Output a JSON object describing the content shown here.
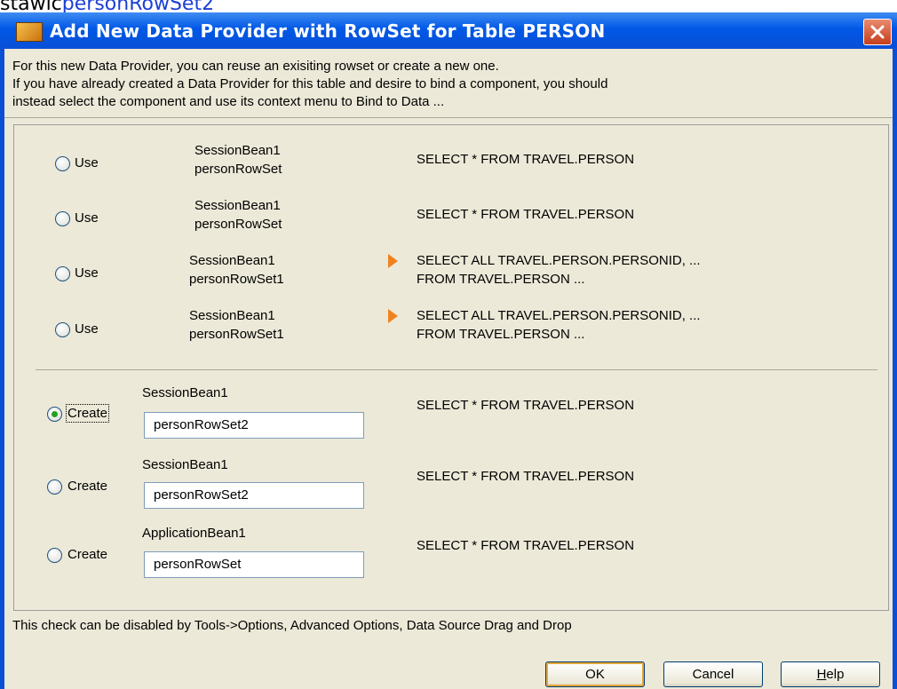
{
  "background": {
    "prefix": "stawic",
    "link": "personRowSet2"
  },
  "dialog": {
    "title": "Add New Data Provider with RowSet for Table PERSON",
    "intro": [
      "For this new Data Provider, you can reuse an exisiting rowset or create a new one.",
      "If you have already created a Data Provider for this table and desire to bind a component, you should",
      "instead select the component and use its context menu to Bind to Data ..."
    ],
    "use_options": [
      {
        "label": "Use",
        "bean": "SessionBean1",
        "rowset": "personRowSet",
        "sql": [
          "SELECT * FROM TRAVEL.PERSON"
        ],
        "expandable": false,
        "selected": false
      },
      {
        "label": "Use",
        "bean": "SessionBean1",
        "rowset": "personRowSet",
        "sql": [
          "SELECT * FROM TRAVEL.PERSON"
        ],
        "expandable": false,
        "selected": false
      },
      {
        "label": "Use",
        "bean": "SessionBean1",
        "rowset": "personRowSet1",
        "sql": [
          "SELECT ALL TRAVEL.PERSON.PERSONID, ...",
          "FROM TRAVEL.PERSON ..."
        ],
        "expandable": true,
        "selected": false
      },
      {
        "label": "Use",
        "bean": "SessionBean1",
        "rowset": "personRowSet1",
        "sql": [
          "SELECT ALL TRAVEL.PERSON.PERSONID, ...",
          "FROM TRAVEL.PERSON ..."
        ],
        "expandable": true,
        "selected": false
      }
    ],
    "create_options": [
      {
        "label": "Create",
        "bean": "SessionBean1",
        "rowset_value": "personRowSet2",
        "sql": "SELECT * FROM TRAVEL.PERSON",
        "selected": true
      },
      {
        "label": "Create",
        "bean": "SessionBean1",
        "rowset_value": "personRowSet2",
        "sql": "SELECT * FROM TRAVEL.PERSON",
        "selected": false
      },
      {
        "label": "Create",
        "bean": "ApplicationBean1",
        "rowset_value": "personRowSet",
        "sql": "SELECT * FROM TRAVEL.PERSON",
        "selected": false
      }
    ],
    "footer_note": "This check can be disabled by Tools->Options, Advanced Options, Data Source Drag and Drop",
    "buttons": {
      "ok": "OK",
      "cancel": "Cancel",
      "help_pre": "",
      "help_mnemonic": "H",
      "help_post": "elp"
    }
  },
  "colors": {
    "title_bar": "#0a4fd6",
    "dialog_bg": "#ece9d8",
    "link": "#1b3fd6",
    "expand_arrow": "#f0821e",
    "radio_selected": "#21a121"
  },
  "icons": {
    "title": "table-icon",
    "close": "close-icon",
    "expand": "expand-arrow-icon"
  }
}
